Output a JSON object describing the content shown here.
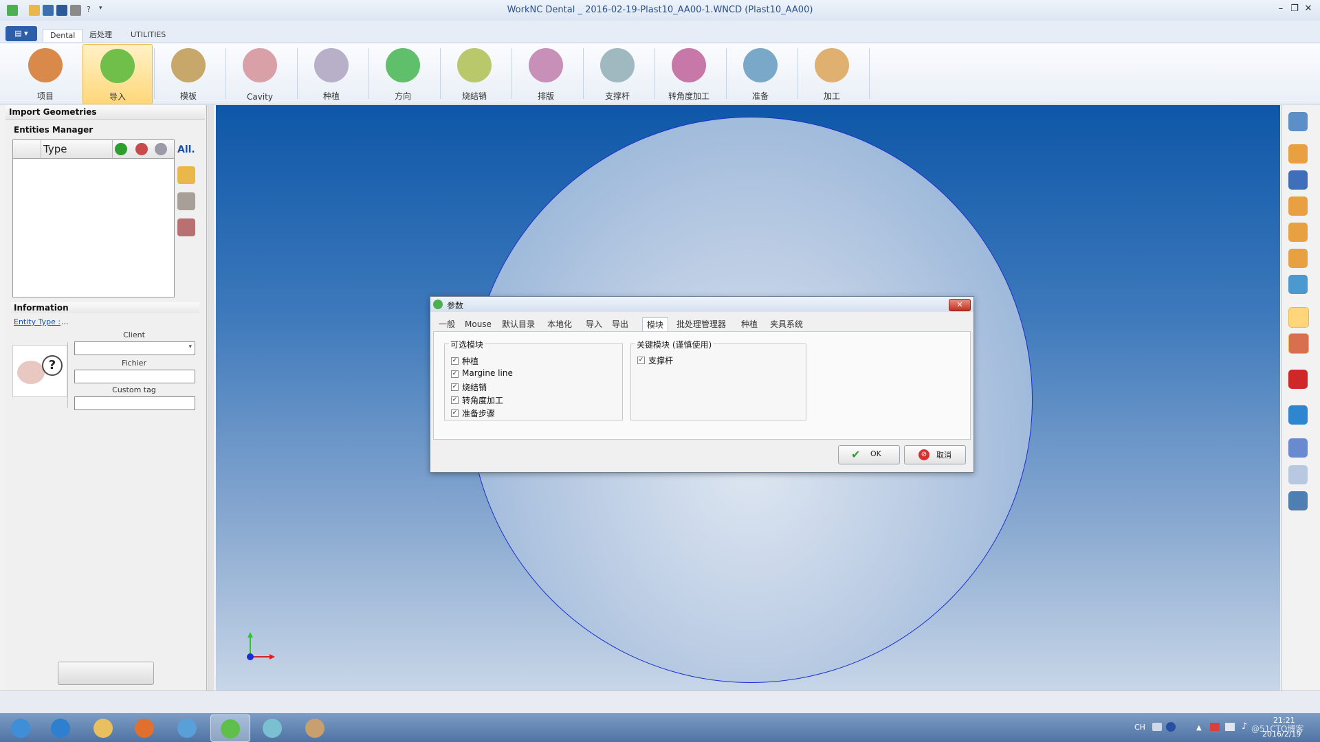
{
  "window": {
    "title": "WorkNC  Dental  _  2016-02-19-Plast10_AA00-1.WNCD  (Plast10_AA00)",
    "quick_access": [
      "app-check-icon",
      "open-folder-icon",
      "save-icon",
      "save-as-icon",
      "tools-icon",
      "help-icon",
      "dropdown-icon"
    ],
    "controls": {
      "minimize": "–",
      "restore": "❐",
      "close": "✕"
    }
  },
  "ribbon_tabs": {
    "app_menu": "▤ ▾",
    "tabs": [
      "Dental",
      "后处理",
      "UTILITIES"
    ],
    "active": "Dental"
  },
  "ribbon": {
    "buttons": [
      {
        "label": "项目",
        "icon": "project-icon",
        "color": "#d98a4a"
      },
      {
        "label": "导入",
        "icon": "import-icon",
        "color": "#6fbf4a",
        "active": true
      },
      {
        "label": "模板",
        "icon": "template-icon",
        "color": "#c8a86a"
      },
      {
        "label": "Cavity",
        "icon": "cavity-icon",
        "color": "#d9a0a8"
      },
      {
        "label": "种植",
        "icon": "implant-icon",
        "color": "#b8b0c8"
      },
      {
        "label": "方向",
        "icon": "direction-icon",
        "color": "#5fbf6a"
      },
      {
        "label": "烧结销",
        "icon": "sinter-pin-icon",
        "color": "#b8c86a"
      },
      {
        "label": "排版",
        "icon": "layout-icon",
        "color": "#c890b8"
      },
      {
        "label": "支撑杆",
        "icon": "support-bar-icon",
        "color": "#a0b8c0"
      },
      {
        "label": "转角度加工",
        "icon": "angle-machining-icon",
        "color": "#c878a8"
      },
      {
        "label": "准备",
        "icon": "prepare-icon",
        "color": "#7aa8c8"
      },
      {
        "label": "加工",
        "icon": "machining-icon",
        "color": "#e0b070"
      }
    ]
  },
  "left_panel": {
    "title": "Import Geometries",
    "entities_manager": {
      "heading": "Entities Manager",
      "column_type": "Type",
      "all_label": "All."
    },
    "information": {
      "heading": "Information",
      "entity_type_label": "Entity Type :",
      "entity_type_value": "...",
      "client_label": "Client",
      "client_value": "",
      "fichier_label": "Fichier",
      "fichier_value": "",
      "custom_tag_label": "Custom tag",
      "custom_tag_value": "",
      "unknown_icon_text": "?"
    }
  },
  "dialog": {
    "title": "参数",
    "tabs": [
      "一般",
      "Mouse",
      "默认目录",
      "本地化",
      "导入",
      "导出",
      "模块",
      "批处理管理器",
      "种植",
      "夹具系统"
    ],
    "active_tab": "模块",
    "optional_modules": {
      "heading": "可选模块",
      "items": [
        {
          "label": "种植",
          "checked": true
        },
        {
          "label": "Margine line",
          "checked": true
        },
        {
          "label": "烧结销",
          "checked": true
        },
        {
          "label": "转角度加工",
          "checked": true
        },
        {
          "label": "准备步骤",
          "checked": true
        }
      ]
    },
    "key_modules": {
      "heading": "关键模块 (谨慎使用)",
      "items": [
        {
          "label": "支撑杆",
          "checked": true
        }
      ]
    },
    "ok_label": "OK",
    "cancel_label": "取消",
    "check_mark": "✓"
  },
  "taskbar": {
    "apps": [
      "start-orb-icon",
      "ie-icon",
      "explorer-icon",
      "media-player-icon",
      "search-app-icon",
      "worknc-icon",
      "worknc-doc-icon",
      "paint-icon"
    ],
    "active_index": 5,
    "lang": "CH",
    "time": "21:21",
    "date": "2016/2/19",
    "watermark": "@51CTO博客"
  }
}
